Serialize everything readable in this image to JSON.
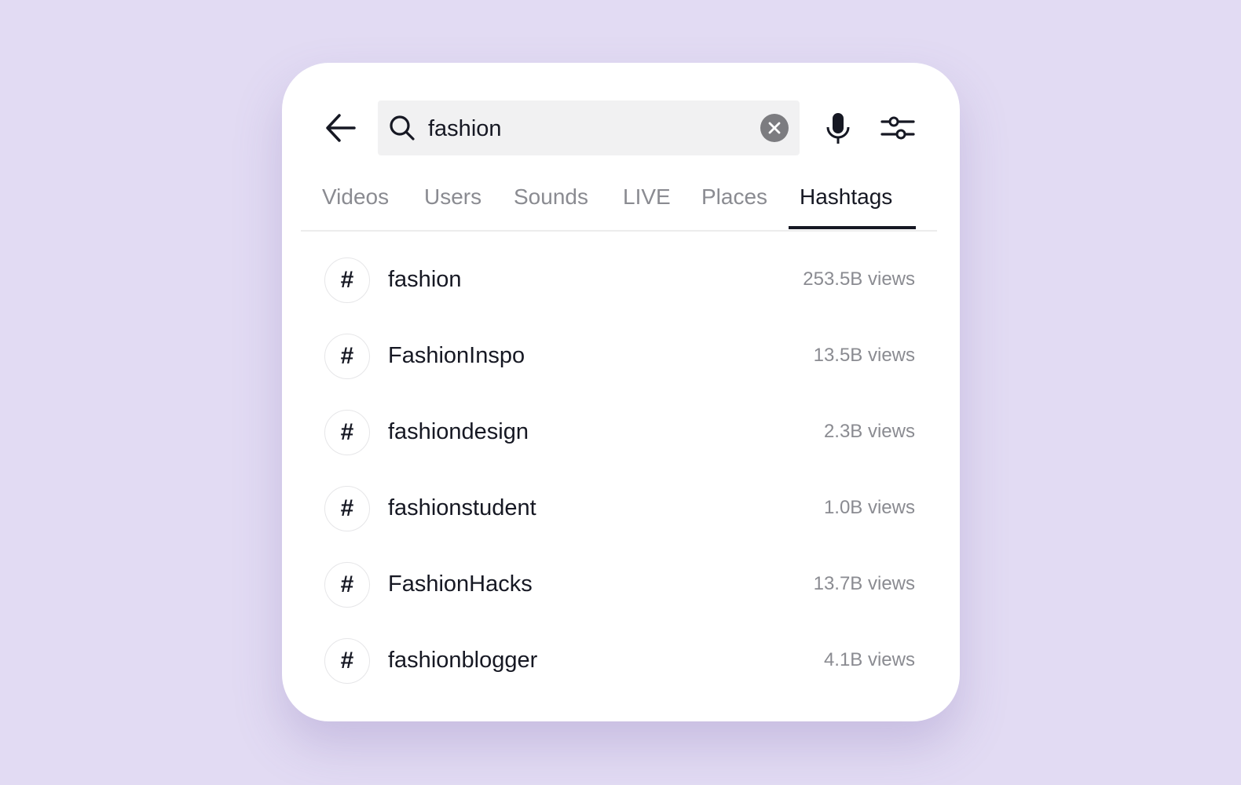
{
  "search": {
    "query": "fashion",
    "placeholder": ""
  },
  "tabs": [
    {
      "label": "Videos",
      "active": false
    },
    {
      "label": "Users",
      "active": false
    },
    {
      "label": "Sounds",
      "active": false
    },
    {
      "label": "LIVE",
      "active": false
    },
    {
      "label": "Places",
      "active": false
    },
    {
      "label": "Hashtags",
      "active": true
    }
  ],
  "hashtags": [
    {
      "icon": "#",
      "name": "fashion",
      "views": "253.5B views"
    },
    {
      "icon": "#",
      "name": "FashionInspo",
      "views": "13.5B views"
    },
    {
      "icon": "#",
      "name": "fashiondesign",
      "views": "2.3B views"
    },
    {
      "icon": "#",
      "name": "fashionstudent",
      "views": "1.0B views"
    },
    {
      "icon": "#",
      "name": "FashionHacks",
      "views": "13.7B views"
    },
    {
      "icon": "#",
      "name": "fashionblogger",
      "views": "4.1B views"
    }
  ],
  "colors": {
    "background": "#e2dbf3",
    "text": "#161823",
    "muted": "#8a8b91"
  }
}
